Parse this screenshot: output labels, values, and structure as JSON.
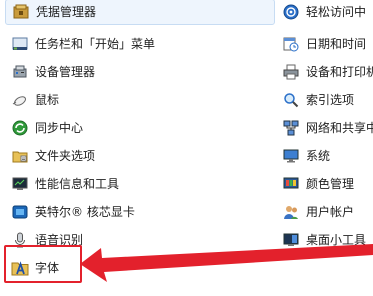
{
  "left_items": [
    {
      "label": "凭据管理器",
      "icon": "credential-manager-icon"
    },
    {
      "label": "任务栏和「开始」菜单",
      "icon": "taskbar-icon"
    },
    {
      "label": "设备管理器",
      "icon": "device-manager-icon"
    },
    {
      "label": "鼠标",
      "icon": "mouse-icon"
    },
    {
      "label": "同步中心",
      "icon": "sync-center-icon"
    },
    {
      "label": "文件夹选项",
      "icon": "folder-options-icon"
    },
    {
      "label": "性能信息和工具",
      "icon": "performance-icon"
    },
    {
      "label": "英特尔® 核芯显卡",
      "icon": "intel-graphics-icon"
    },
    {
      "label": "语音识别",
      "icon": "microphone-icon"
    },
    {
      "label": "字体",
      "icon": "fonts-icon"
    }
  ],
  "right_items": [
    {
      "label": "轻松访问中",
      "icon": "ease-of-access-icon"
    },
    {
      "label": "日期和时间",
      "icon": "date-time-icon"
    },
    {
      "label": "设备和打印机",
      "icon": "printer-icon"
    },
    {
      "label": "索引选项",
      "icon": "indexing-icon"
    },
    {
      "label": "网络和共享中",
      "icon": "network-icon"
    },
    {
      "label": "系统",
      "icon": "system-icon"
    },
    {
      "label": "颜色管理",
      "icon": "color-management-icon"
    },
    {
      "label": "用户帐户",
      "icon": "user-accounts-icon"
    },
    {
      "label": "桌面小工具",
      "icon": "gadgets-icon"
    }
  ],
  "colors": {
    "arrow": "#e3212c",
    "highlight_border": "#c7dcf3"
  }
}
